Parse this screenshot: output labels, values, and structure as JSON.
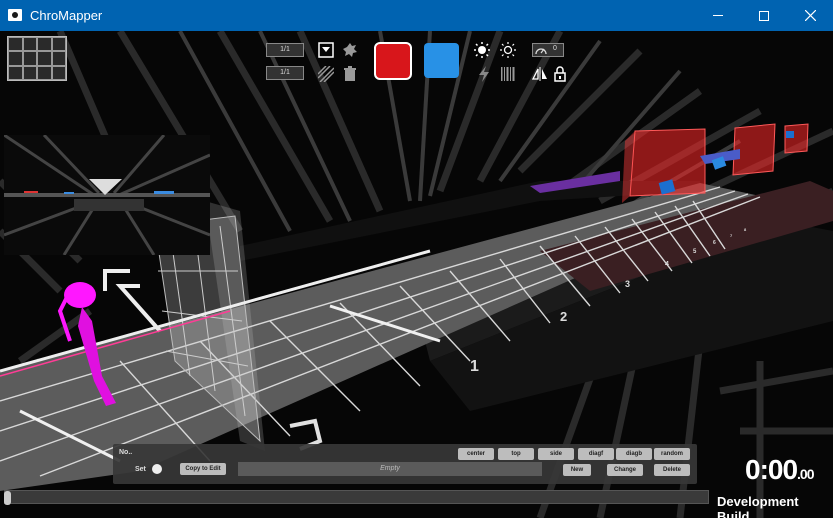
{
  "window": {
    "title": "ChroMapper"
  },
  "toolbar": {
    "precision_top": "1/1",
    "precision_bottom": "1/1",
    "bpm_value": "0",
    "colors": {
      "left_note": "#d8161b",
      "right_note": "#2891e6"
    },
    "icons": [
      "placement-mode-icon",
      "bomb-icon",
      "stripes-icon",
      "trash-icon",
      "light-on-icon",
      "light-off-icon",
      "lightning-icon",
      "barcode-icon",
      "speedometer-icon",
      "mirror-icon",
      "lock-icon"
    ]
  },
  "track": {
    "beat_numbers": [
      "1",
      "2",
      "3",
      "4",
      "5",
      "6",
      "7",
      "8"
    ]
  },
  "bottom_panel": {
    "node_name": "No..",
    "set_label": "Set",
    "copy_button": "Copy to Edit",
    "empty_text": "Empty",
    "presets": [
      "center",
      "top",
      "side",
      "diagf",
      "diagb",
      "random"
    ],
    "new_button": "New",
    "change_button": "Change",
    "delete_button": "Delete"
  },
  "timer": {
    "main": "0:00",
    "fraction": ".00"
  },
  "status": {
    "build": "Development Build"
  }
}
